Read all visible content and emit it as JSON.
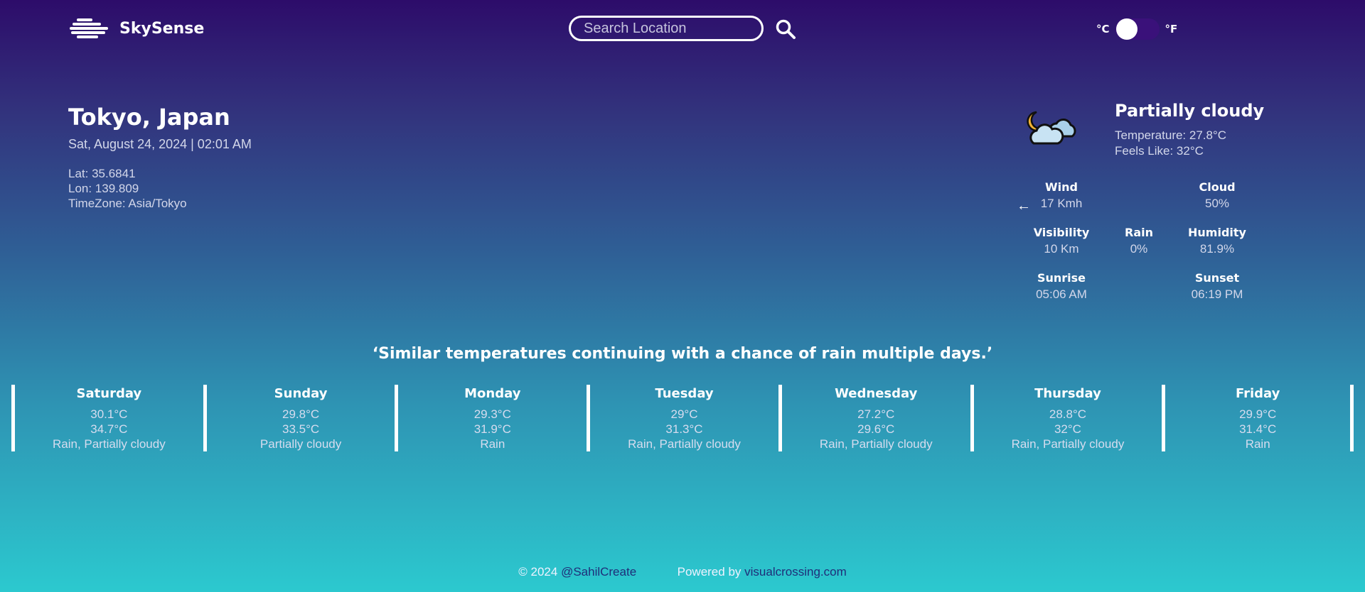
{
  "header": {
    "app_name": "SkySense",
    "search": {
      "placeholder": "Search Location",
      "value": ""
    },
    "units": {
      "celsius": "°C",
      "fahrenheit": "°F",
      "selected": "°C"
    }
  },
  "location": {
    "city": "Tokyo, Japan",
    "datetime": "Sat, August 24, 2024 | 02:01 AM",
    "lat": "Lat: 35.6841",
    "lon": "Lon: 139.809",
    "timezone": "TimeZone: Asia/Tokyo"
  },
  "current": {
    "icon": "partly-cloudy-night-icon",
    "condition": "Partially cloudy",
    "temperature": "Temperature: 27.8°C",
    "feels_like": "Feels Like: 32°C",
    "wind": {
      "label": "Wind",
      "value": "17 Kmh"
    },
    "cloud": {
      "label": "Cloud",
      "value": "50%"
    },
    "visibility": {
      "label": "Visibility",
      "value": "10 Km"
    },
    "rain": {
      "label": "Rain",
      "value": "0%"
    },
    "humidity": {
      "label": "Humidity",
      "value": "81.9%"
    },
    "sunrise": {
      "label": "Sunrise",
      "value": "05:06 AM"
    },
    "sunset": {
      "label": "Sunset",
      "value": "06:19 PM"
    }
  },
  "summary": "‘Similar temperatures continuing with a chance of rain multiple days.’",
  "forecast": [
    {
      "day": "Saturday",
      "min": "30.1°C",
      "max": "34.7°C",
      "conditions": "Rain, Partially cloudy"
    },
    {
      "day": "Sunday",
      "min": "29.8°C",
      "max": "33.5°C",
      "conditions": "Partially cloudy"
    },
    {
      "day": "Monday",
      "min": "29.3°C",
      "max": "31.9°C",
      "conditions": "Rain"
    },
    {
      "day": "Tuesday",
      "min": "29°C",
      "max": "31.3°C",
      "conditions": "Rain, Partially cloudy"
    },
    {
      "day": "Wednesday",
      "min": "27.2°C",
      "max": "29.6°C",
      "conditions": "Rain, Partially cloudy"
    },
    {
      "day": "Thursday",
      "min": "28.8°C",
      "max": "32°C",
      "conditions": "Rain, Partially cloudy"
    },
    {
      "day": "Friday",
      "min": "29.9°C",
      "max": "31.4°C",
      "conditions": "Rain"
    }
  ],
  "footer": {
    "copyright": "© 2024",
    "author_link": "@SahilCreate",
    "powered_by": "Powered by",
    "provider_link": "visualcrossing.com"
  },
  "colors": {
    "gradient_top": "#2d0c6a",
    "gradient_bottom": "#2cc9cf",
    "link": "#1f2e79",
    "text": "#ffffff"
  }
}
